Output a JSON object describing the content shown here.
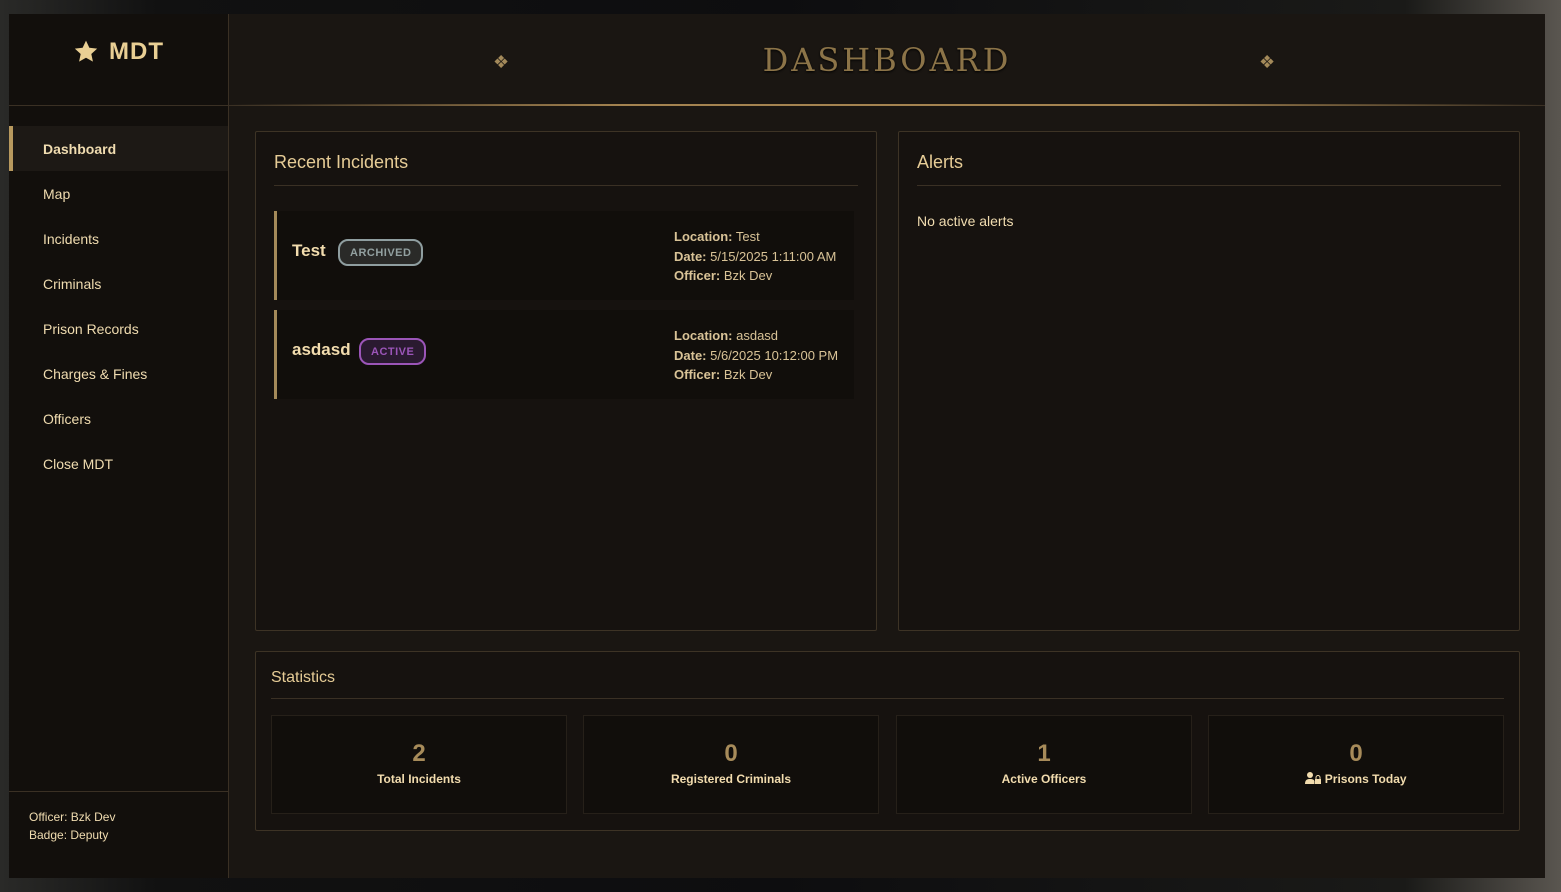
{
  "app": {
    "logo_text": "MDT",
    "title": "DASHBOARD"
  },
  "sidebar": {
    "items": [
      {
        "label": "Dashboard"
      },
      {
        "label": "Map"
      },
      {
        "label": "Incidents"
      },
      {
        "label": "Criminals"
      },
      {
        "label": "Prison Records"
      },
      {
        "label": "Charges & Fines"
      },
      {
        "label": "Officers"
      },
      {
        "label": "Close MDT"
      }
    ],
    "officer": "Officer: Bzk Dev",
    "badge": "Badge: Deputy"
  },
  "incidents": {
    "title": "Recent Incidents",
    "items": [
      {
        "title": "Test",
        "status": "ARCHIVED",
        "location_label": "Location:",
        "location": " Test",
        "date_label": "Date:",
        "date": " 5/15/2025 1:11:00 AM",
        "officer_label": "Officer:",
        "officer": " Bzk Dev"
      },
      {
        "title": "asdasd",
        "status": "ACTIVE",
        "location_label": "Location:",
        "location": " asdasd",
        "date_label": "Date:",
        "date": " 5/6/2025 10:12:00 PM",
        "officer_label": "Officer:",
        "officer": " Bzk Dev"
      }
    ]
  },
  "alerts": {
    "title": "Alerts",
    "empty": "No active alerts"
  },
  "statistics": {
    "title": "Statistics",
    "items": [
      {
        "value": "2",
        "label": "Total Incidents"
      },
      {
        "value": "0",
        "label": "Registered Criminals"
      },
      {
        "value": "1",
        "label": "Active Officers"
      },
      {
        "value": "0",
        "label": "Prisons Today",
        "icon": "user-lock-icon"
      }
    ]
  },
  "colors": {
    "accent": "#b8995e",
    "active": "#9b55b8",
    "archived": "#8f9ea0"
  }
}
